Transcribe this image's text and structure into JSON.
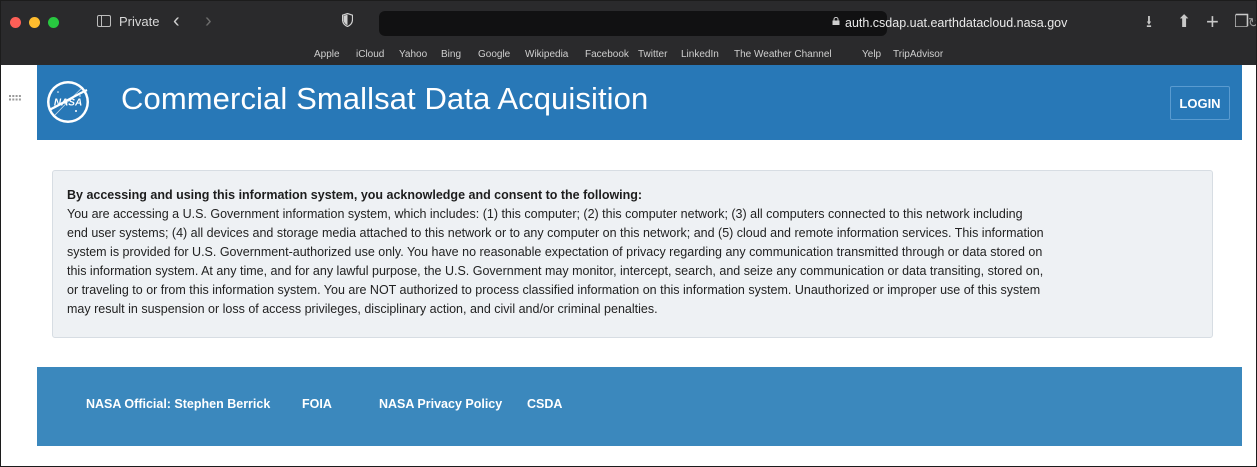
{
  "browser": {
    "private_label": "Private",
    "url": "auth.csdap.uat.earthdatacloud.nasa.gov",
    "favorites": [
      "Apple",
      "iCloud",
      "Yahoo",
      "Bing",
      "Google",
      "Wikipedia",
      "Facebook",
      "Twitter",
      "LinkedIn",
      "The Weather Channel",
      "Yelp",
      "TripAdvisor"
    ]
  },
  "header": {
    "title": "Commercial Smallsat Data Acquisition",
    "login_label": "LOGIN",
    "logo_text": "NASA"
  },
  "notice": {
    "heading": "By accessing and using this information system, you acknowledge and consent to the following:",
    "lines": [
      "You are accessing a U.S. Government information system, which includes: (1) this computer; (2) this computer network; (3) all computers connected to this network including",
      "end user systems; (4) all devices and storage media attached to this network or to any computer on this network; and (5) cloud and remote information services. This information",
      "system is provided for U.S. Government-authorized use only. You have no reasonable expectation of privacy regarding any communication transmitted through or data stored on",
      "this information system. At any time, and for any lawful purpose, the U.S. Government may monitor, intercept, search, and seize any communication or data transiting, stored on,",
      "or traveling to or from this information system. You are NOT authorized to process classified information on this information system. Unauthorized or improper use of this system",
      "may result in suspension or loss of access privileges, disciplinary action, and civil and/or criminal penalties."
    ]
  },
  "footer": {
    "official": "NASA Official: Stephen Berrick",
    "foia": "FOIA",
    "privacy": "NASA Privacy Policy",
    "csda": "CSDA"
  },
  "colors": {
    "header_bg": "#2878b7",
    "footer_bg": "#3b88bd",
    "notice_bg": "#eef1f4",
    "browser_chrome": "#2a2a2c"
  }
}
